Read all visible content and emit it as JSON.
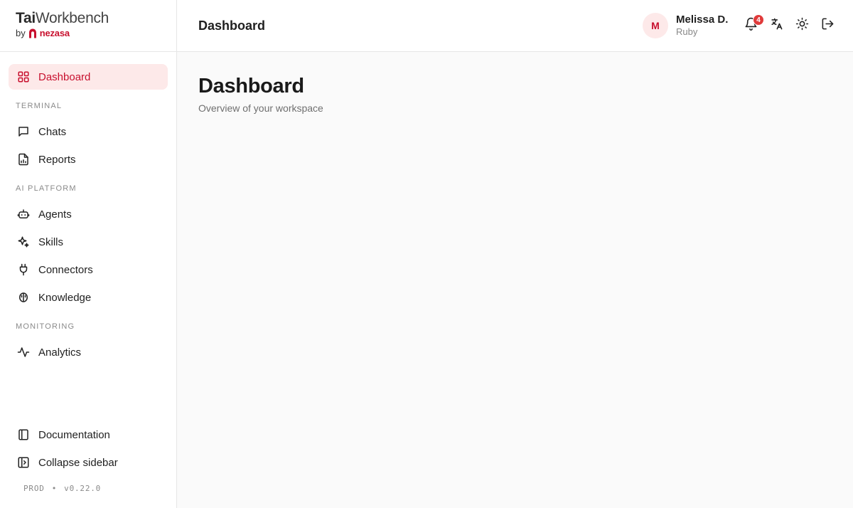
{
  "brand": {
    "name_bold": "Tai",
    "name_light": "Workbench",
    "by": "by",
    "company": "nezasa"
  },
  "sidebar": {
    "primary": {
      "label": "Dashboard",
      "icon": "grid-icon"
    },
    "sections": [
      {
        "label": "TERMINAL",
        "items": [
          {
            "label": "Chats",
            "icon": "chat-icon"
          },
          {
            "label": "Reports",
            "icon": "report-icon"
          }
        ]
      },
      {
        "label": "AI PLATFORM",
        "items": [
          {
            "label": "Agents",
            "icon": "bot-icon"
          },
          {
            "label": "Skills",
            "icon": "sparkles-icon"
          },
          {
            "label": "Connectors",
            "icon": "plug-icon"
          },
          {
            "label": "Knowledge",
            "icon": "brain-icon"
          }
        ]
      },
      {
        "label": "MONITORING",
        "items": [
          {
            "label": "Analytics",
            "icon": "activity-icon"
          }
        ]
      }
    ],
    "bottom": [
      {
        "label": "Documentation",
        "icon": "book-icon"
      },
      {
        "label": "Collapse sidebar",
        "icon": "sidebar-collapse-icon"
      }
    ],
    "env": "PROD",
    "separator": "•",
    "version": "v0.22.0"
  },
  "topbar": {
    "title": "Dashboard",
    "user": {
      "initial": "M",
      "name": "Melissa D.",
      "org": "Ruby"
    },
    "notifications_count": "4"
  },
  "main": {
    "title": "Dashboard",
    "subtitle": "Overview of your workspace"
  },
  "colors": {
    "accent": "#c8102e",
    "active_bg": "#fde9e9",
    "badge": "#e03b3b"
  }
}
